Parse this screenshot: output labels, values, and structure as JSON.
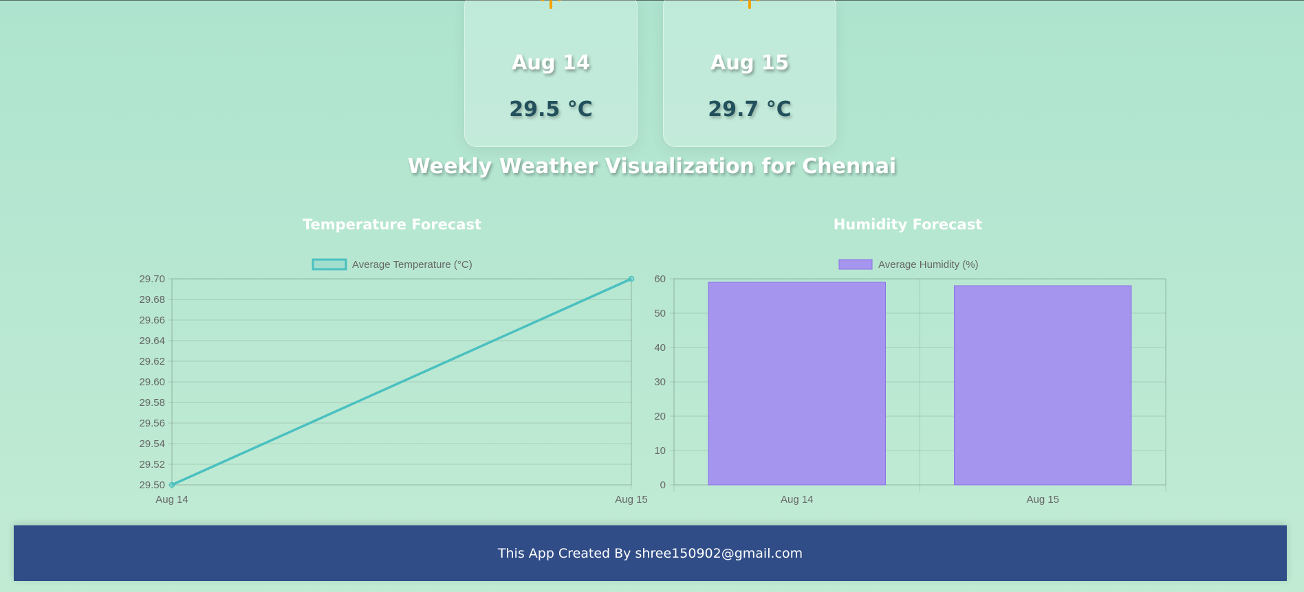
{
  "forecast_cards": [
    {
      "date": "Aug 14",
      "temp": "29.5 °C",
      "icon": "sun-icon"
    },
    {
      "date": "Aug 15",
      "temp": "29.7 °C",
      "icon": "sun-icon"
    }
  ],
  "page_title": "Weekly Weather Visualization for Chennai",
  "colors": {
    "temperature_line": "#4bc0c0",
    "humidity_bar_fill": "#a695ee",
    "humidity_bar_border": "#8a6fe8",
    "sun_rays": "#f5a300",
    "footer_bg": "#304d87"
  },
  "chart_data": [
    {
      "type": "line",
      "title": "Temperature Forecast",
      "categories": [
        "Aug 14",
        "Aug 15"
      ],
      "series": [
        {
          "name": "Average Temperature (°C)",
          "values": [
            29.5,
            29.7
          ]
        }
      ],
      "ylim": [
        29.5,
        29.7
      ],
      "yticks": [
        "29.50",
        "29.52",
        "29.54",
        "29.56",
        "29.58",
        "29.60",
        "29.62",
        "29.64",
        "29.66",
        "29.68",
        "29.70"
      ],
      "grid": true,
      "legend": "top"
    },
    {
      "type": "bar",
      "title": "Humidity Forecast",
      "categories": [
        "Aug 14",
        "Aug 15"
      ],
      "series": [
        {
          "name": "Average Humidity (%)",
          "values": [
            59,
            58
          ]
        }
      ],
      "ylim": [
        0,
        60
      ],
      "yticks": [
        "0",
        "10",
        "20",
        "30",
        "40",
        "50",
        "60"
      ],
      "grid": true,
      "legend": "top"
    }
  ],
  "footer": {
    "text": "This App Created By shree150902@gmail.com"
  }
}
